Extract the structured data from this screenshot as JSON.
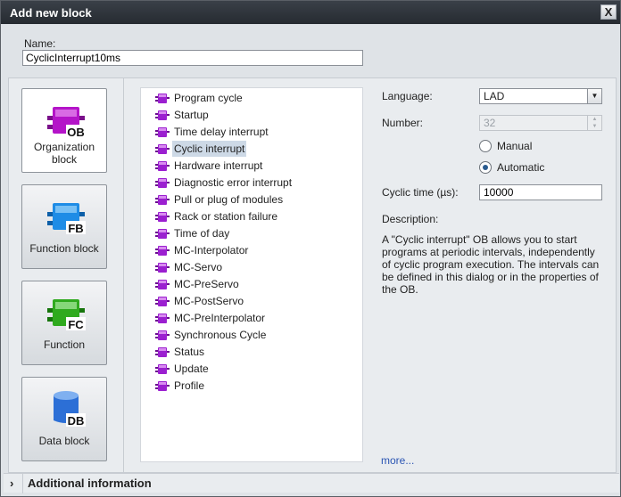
{
  "dialog": {
    "title": "Add new block",
    "close_glyph": "X"
  },
  "name": {
    "label": "Name:",
    "value": "CyclicInterrupt10ms"
  },
  "block_types": [
    {
      "label_line1": "Organization",
      "label_line2": "block",
      "icon": "ob-block-icon",
      "icon_text": "OB",
      "color": "#b414c8",
      "selected": true
    },
    {
      "label_line1": "Function block",
      "label_line2": "",
      "icon": "fb-block-icon",
      "icon_text": "FB",
      "color": "#1e8ce6",
      "selected": false
    },
    {
      "label_line1": "Function",
      "label_line2": "",
      "icon": "fc-block-icon",
      "icon_text": "FC",
      "color": "#2faa1e",
      "selected": false
    },
    {
      "label_line1": "Data block",
      "label_line2": "",
      "icon": "db-block-icon",
      "icon_text": "DB",
      "color": "#2c6fd6",
      "selected": false
    }
  ],
  "ob_list": {
    "items": [
      "Program cycle",
      "Startup",
      "Time delay interrupt",
      "Cyclic interrupt",
      "Hardware interrupt",
      "Diagnostic error interrupt",
      "Pull or plug of modules",
      "Rack or station failure",
      "Time of day",
      "MC-Interpolator",
      "MC-Servo",
      "MC-PreServo",
      "MC-PostServo",
      "MC-PreInterpolator",
      "Synchronous Cycle",
      "Status",
      "Update",
      "Profile"
    ],
    "selected_index": 3,
    "item_color": "#9b1fd0"
  },
  "properties": {
    "language_label": "Language:",
    "language_value": "LAD",
    "number_label": "Number:",
    "number_value": "32",
    "manual_label": "Manual",
    "automatic_label": "Automatic",
    "numbering_mode": "Automatic",
    "cyclic_time_label": "Cyclic time (µs):",
    "cyclic_time_value": "10000",
    "description_label": "Description:",
    "description_text": "A \"Cyclic interrupt\" OB allows you to start programs at periodic intervals, independently of cyclic program execution. The intervals can be defined in this dialog or in the properties of the OB.",
    "more_link": "more..."
  },
  "footer": {
    "additional_info_label": "Additional information",
    "chevron": "›"
  }
}
